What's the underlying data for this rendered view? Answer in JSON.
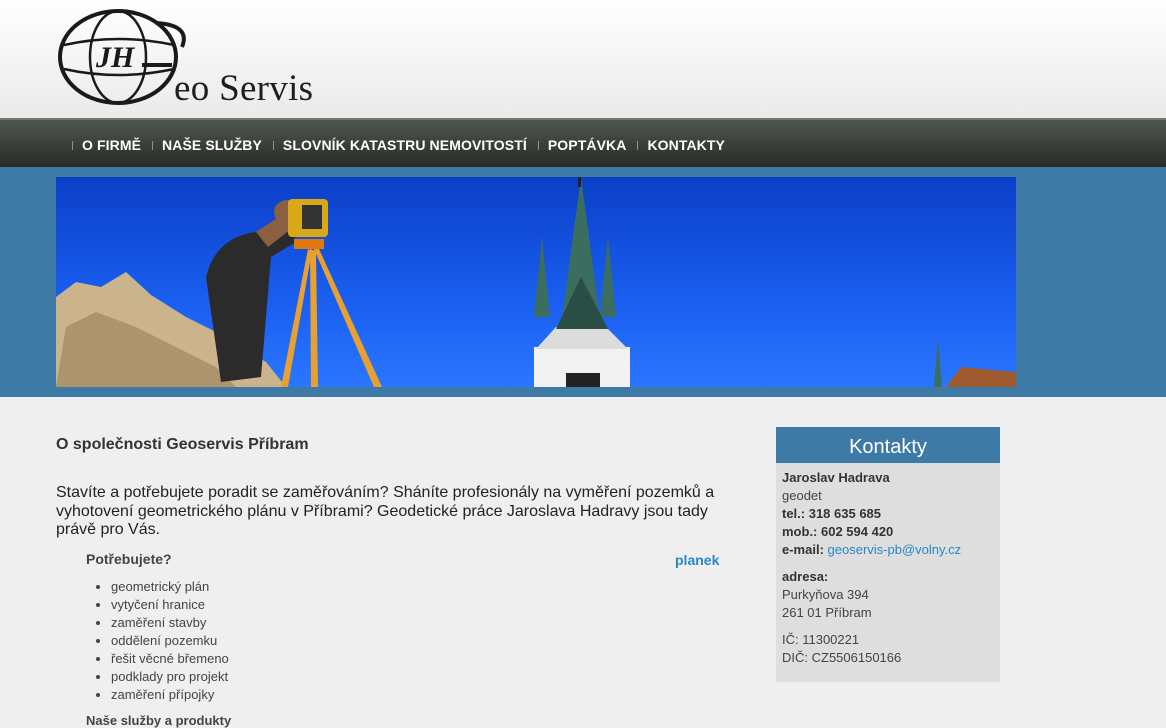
{
  "brand": {
    "name": "eo Servis",
    "monogram": "JH"
  },
  "nav": {
    "items": [
      "O FIRMĚ",
      "NAŠE SLUŽBY",
      "SLOVNÍK KATASTRU NEMOVITOSTÍ",
      "POPTÁVKA",
      "KONTAKTY"
    ]
  },
  "main": {
    "title": "O společnosti Geoservis Příbram",
    "intro": "Stavíte a potřebujete poradit se zaměřováním? Sháníte profesionály na vyměření pozemků a vyhotovení geometrického plánu v Příbrami? Geodetické práce Jaroslava Hadravy jsou tady právě pro Vás.",
    "needs_heading": "Potřebujete?",
    "planek_link": "planek",
    "needs": [
      "geometrický plán",
      "vytyčení hranice",
      "zaměření stavby",
      "oddělení pozemku",
      "řešit věcné břemeno",
      "podklady pro projekt",
      "zaměření přípojky"
    ],
    "products_heading": "Naše služby a produkty"
  },
  "contact": {
    "heading": "Kontakty",
    "name": "Jaroslav Hadrava",
    "role": "geodet",
    "tel": "tel.: 318 635 685",
    "mob": "mob.: 602 594 420",
    "email_label": "e-mail:",
    "email": "geoservis-pb@volny.cz",
    "address_label": "adresa:",
    "street": "Purkyňova 394",
    "city": "261 01 Příbram",
    "ic": "IČ: 11300221",
    "dic": "DIČ: CZ5506150166"
  },
  "colors": {
    "accent_blue": "#3d7aa6",
    "link_blue": "#2a86c6",
    "nav_dark": "#2f342f"
  }
}
